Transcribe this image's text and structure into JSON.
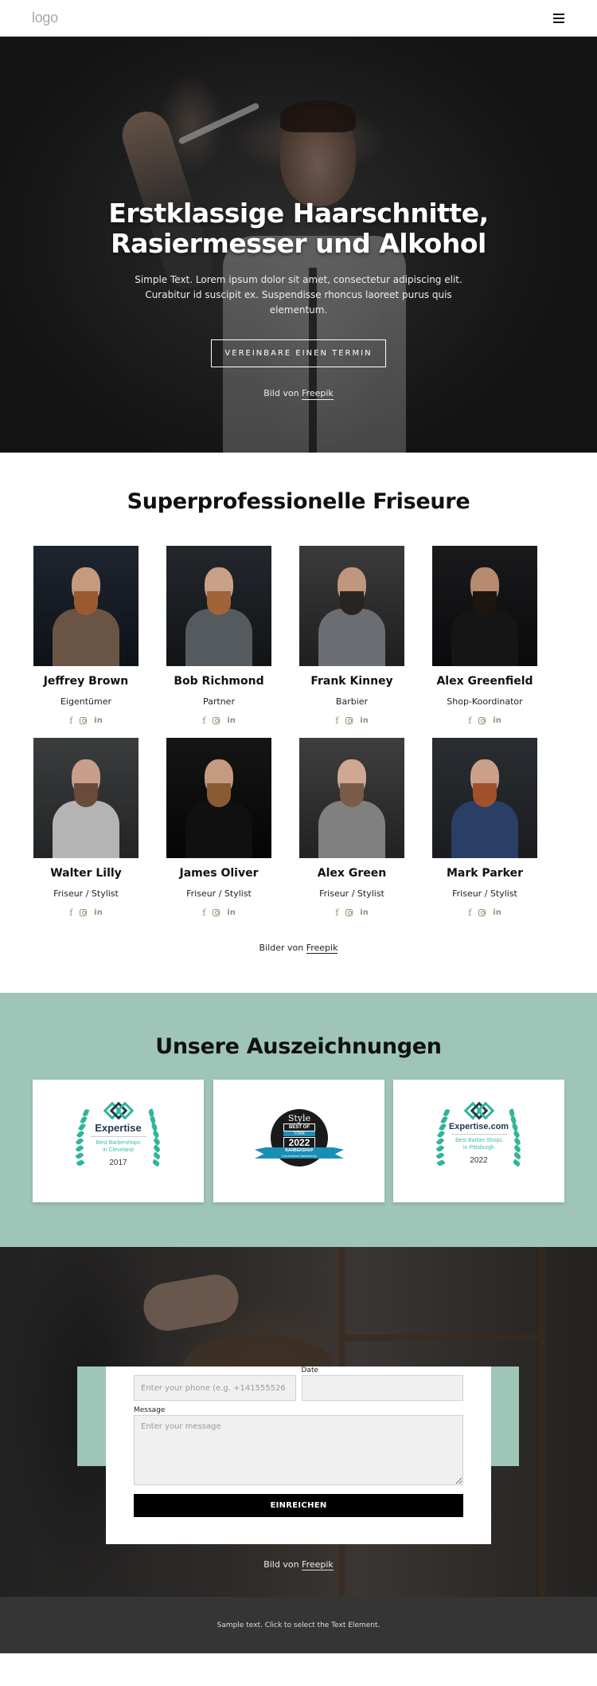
{
  "header": {
    "logo": "logo",
    "menu_icon": "hamburger-menu-icon"
  },
  "hero": {
    "title_line1": "Erstklassige Haarschnitte,",
    "title_line2": "Rasiermesser und Alkohol",
    "text": "Simple Text. Lorem ipsum dolor sit amet, consectetur adipiscing elit. Curabitur id suscipit ex. Suspendisse rhoncus laoreet purus quis elementum.",
    "button_label": "VEREINBARE EINEN TERMIN",
    "credit_prefix": "Bild von",
    "credit_link": "Freepik"
  },
  "team": {
    "title": "Superprofessionelle Friseure",
    "members": [
      {
        "name": "Jeffrey Brown",
        "role": "Eigentümer"
      },
      {
        "name": "Bob Richmond",
        "role": "Partner"
      },
      {
        "name": "Frank Kinney",
        "role": "Barbier"
      },
      {
        "name": "Alex Greenfield",
        "role": "Shop-Koordinator"
      },
      {
        "name": "Walter Lilly",
        "role": "Friseur / Stylist"
      },
      {
        "name": "James Oliver",
        "role": "Friseur / Stylist"
      },
      {
        "name": "Alex Green",
        "role": "Friseur / Stylist"
      },
      {
        "name": "Mark Parker",
        "role": "Friseur / Stylist"
      }
    ],
    "social_icons": [
      "facebook-icon",
      "instagram-icon",
      "linkedin-icon"
    ],
    "social_glyphs": {
      "facebook": "f",
      "linkedin": "in"
    },
    "credit_prefix": "Bilder von",
    "credit_link": "Freepik"
  },
  "awards": {
    "title": "Unsere Auszeichnungen",
    "items": [
      {
        "brand": "Expertise",
        "subtitle_line1": "Best Barbershops",
        "subtitle_line2": "in Cleveland",
        "year": "2017"
      },
      {
        "brand": "Style",
        "line1": "BEST OF",
        "line2": "YORK",
        "year": "2022",
        "ribbon": "BARBERSHOP",
        "ribbon_sub": "Cornerstone Barbershop"
      },
      {
        "brand": "Expertise.com",
        "subtitle_line1": "Best Barber Shops",
        "subtitle_line2": "in Pittsburgh",
        "year": "2022"
      }
    ]
  },
  "contact": {
    "phone_placeholder": "Enter your phone (e.g. +141555526",
    "date_label": "Date",
    "date_value": "",
    "message_label": "Message",
    "message_placeholder": "Enter your message",
    "submit_label": "EINREICHEN",
    "credit_prefix": "Bild von",
    "credit_link": "Freepik"
  },
  "footer": {
    "text": "Sample text. Click to select the Text Element."
  },
  "colors": {
    "accent_mint": "#9ec5b8",
    "social_icon": "#9a8f74",
    "footer_bg": "#353535",
    "button_black": "#000000"
  }
}
